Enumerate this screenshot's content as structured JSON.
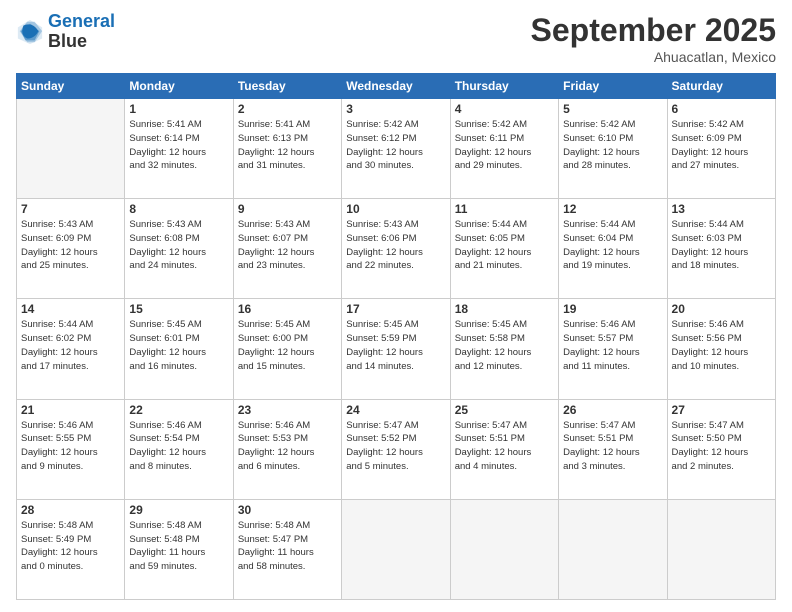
{
  "header": {
    "logo_line1": "General",
    "logo_line2": "Blue",
    "month": "September 2025",
    "location": "Ahuacatlan, Mexico"
  },
  "days_of_week": [
    "Sunday",
    "Monday",
    "Tuesday",
    "Wednesday",
    "Thursday",
    "Friday",
    "Saturday"
  ],
  "weeks": [
    [
      {
        "day": "",
        "info": ""
      },
      {
        "day": "1",
        "info": "Sunrise: 5:41 AM\nSunset: 6:14 PM\nDaylight: 12 hours\nand 32 minutes."
      },
      {
        "day": "2",
        "info": "Sunrise: 5:41 AM\nSunset: 6:13 PM\nDaylight: 12 hours\nand 31 minutes."
      },
      {
        "day": "3",
        "info": "Sunrise: 5:42 AM\nSunset: 6:12 PM\nDaylight: 12 hours\nand 30 minutes."
      },
      {
        "day": "4",
        "info": "Sunrise: 5:42 AM\nSunset: 6:11 PM\nDaylight: 12 hours\nand 29 minutes."
      },
      {
        "day": "5",
        "info": "Sunrise: 5:42 AM\nSunset: 6:10 PM\nDaylight: 12 hours\nand 28 minutes."
      },
      {
        "day": "6",
        "info": "Sunrise: 5:42 AM\nSunset: 6:09 PM\nDaylight: 12 hours\nand 27 minutes."
      }
    ],
    [
      {
        "day": "7",
        "info": "Sunrise: 5:43 AM\nSunset: 6:09 PM\nDaylight: 12 hours\nand 25 minutes."
      },
      {
        "day": "8",
        "info": "Sunrise: 5:43 AM\nSunset: 6:08 PM\nDaylight: 12 hours\nand 24 minutes."
      },
      {
        "day": "9",
        "info": "Sunrise: 5:43 AM\nSunset: 6:07 PM\nDaylight: 12 hours\nand 23 minutes."
      },
      {
        "day": "10",
        "info": "Sunrise: 5:43 AM\nSunset: 6:06 PM\nDaylight: 12 hours\nand 22 minutes."
      },
      {
        "day": "11",
        "info": "Sunrise: 5:44 AM\nSunset: 6:05 PM\nDaylight: 12 hours\nand 21 minutes."
      },
      {
        "day": "12",
        "info": "Sunrise: 5:44 AM\nSunset: 6:04 PM\nDaylight: 12 hours\nand 19 minutes."
      },
      {
        "day": "13",
        "info": "Sunrise: 5:44 AM\nSunset: 6:03 PM\nDaylight: 12 hours\nand 18 minutes."
      }
    ],
    [
      {
        "day": "14",
        "info": "Sunrise: 5:44 AM\nSunset: 6:02 PM\nDaylight: 12 hours\nand 17 minutes."
      },
      {
        "day": "15",
        "info": "Sunrise: 5:45 AM\nSunset: 6:01 PM\nDaylight: 12 hours\nand 16 minutes."
      },
      {
        "day": "16",
        "info": "Sunrise: 5:45 AM\nSunset: 6:00 PM\nDaylight: 12 hours\nand 15 minutes."
      },
      {
        "day": "17",
        "info": "Sunrise: 5:45 AM\nSunset: 5:59 PM\nDaylight: 12 hours\nand 14 minutes."
      },
      {
        "day": "18",
        "info": "Sunrise: 5:45 AM\nSunset: 5:58 PM\nDaylight: 12 hours\nand 12 minutes."
      },
      {
        "day": "19",
        "info": "Sunrise: 5:46 AM\nSunset: 5:57 PM\nDaylight: 12 hours\nand 11 minutes."
      },
      {
        "day": "20",
        "info": "Sunrise: 5:46 AM\nSunset: 5:56 PM\nDaylight: 12 hours\nand 10 minutes."
      }
    ],
    [
      {
        "day": "21",
        "info": "Sunrise: 5:46 AM\nSunset: 5:55 PM\nDaylight: 12 hours\nand 9 minutes."
      },
      {
        "day": "22",
        "info": "Sunrise: 5:46 AM\nSunset: 5:54 PM\nDaylight: 12 hours\nand 8 minutes."
      },
      {
        "day": "23",
        "info": "Sunrise: 5:46 AM\nSunset: 5:53 PM\nDaylight: 12 hours\nand 6 minutes."
      },
      {
        "day": "24",
        "info": "Sunrise: 5:47 AM\nSunset: 5:52 PM\nDaylight: 12 hours\nand 5 minutes."
      },
      {
        "day": "25",
        "info": "Sunrise: 5:47 AM\nSunset: 5:51 PM\nDaylight: 12 hours\nand 4 minutes."
      },
      {
        "day": "26",
        "info": "Sunrise: 5:47 AM\nSunset: 5:51 PM\nDaylight: 12 hours\nand 3 minutes."
      },
      {
        "day": "27",
        "info": "Sunrise: 5:47 AM\nSunset: 5:50 PM\nDaylight: 12 hours\nand 2 minutes."
      }
    ],
    [
      {
        "day": "28",
        "info": "Sunrise: 5:48 AM\nSunset: 5:49 PM\nDaylight: 12 hours\nand 0 minutes."
      },
      {
        "day": "29",
        "info": "Sunrise: 5:48 AM\nSunset: 5:48 PM\nDaylight: 11 hours\nand 59 minutes."
      },
      {
        "day": "30",
        "info": "Sunrise: 5:48 AM\nSunset: 5:47 PM\nDaylight: 11 hours\nand 58 minutes."
      },
      {
        "day": "",
        "info": ""
      },
      {
        "day": "",
        "info": ""
      },
      {
        "day": "",
        "info": ""
      },
      {
        "day": "",
        "info": ""
      }
    ]
  ]
}
